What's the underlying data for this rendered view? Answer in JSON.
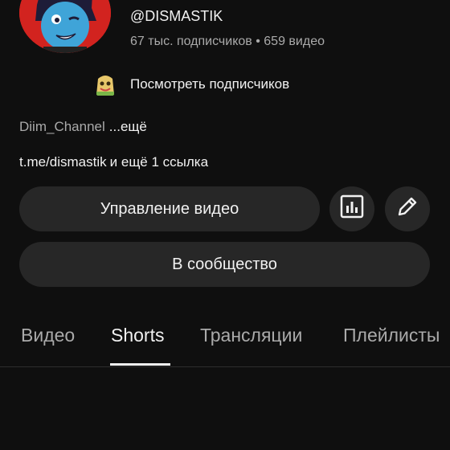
{
  "channel": {
    "handle": "@DISMASTIK",
    "stats": "67 тыс. подписчиков • 659 видео",
    "view_subscribers": "Посмотреть подписчиков",
    "description_name": "Diim_Channel",
    "description_more": "...ещё",
    "link": "t.me/dismastik",
    "link_extra": "и ещё 1 ссылка"
  },
  "actions": {
    "manage_videos": "Управление видео",
    "community": "В сообщество"
  },
  "tabs": [
    {
      "label": "Видео"
    },
    {
      "label": "Shorts"
    },
    {
      "label": "Трансляции"
    },
    {
      "label": "Плейлисты"
    }
  ],
  "active_tab": "Shorts",
  "icons": {
    "stats": "bar-chart-icon",
    "edit": "pencil-icon"
  },
  "colors": {
    "background": "#0f0f0f",
    "button": "#272727",
    "avatar_ring": "#d2231f"
  }
}
